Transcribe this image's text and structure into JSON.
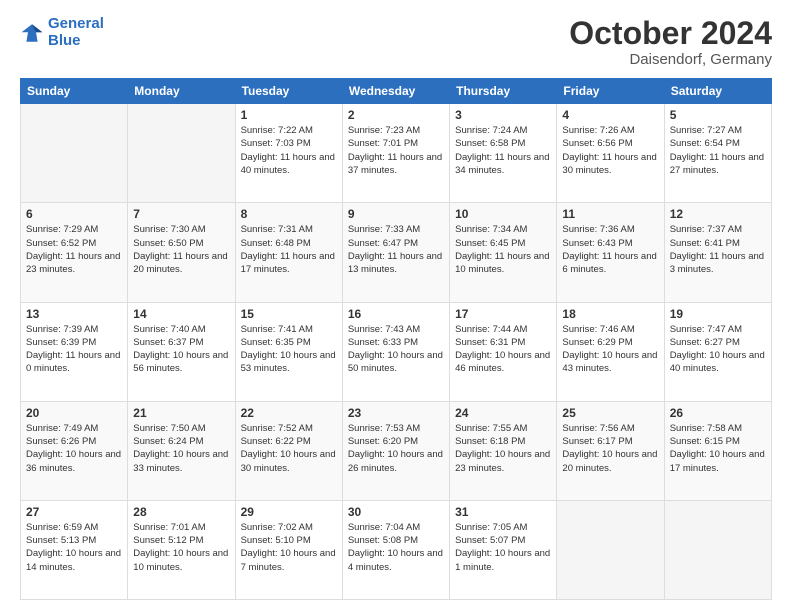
{
  "header": {
    "logo_line1": "General",
    "logo_line2": "Blue",
    "month": "October 2024",
    "location": "Daisendorf, Germany"
  },
  "weekdays": [
    "Sunday",
    "Monday",
    "Tuesday",
    "Wednesday",
    "Thursday",
    "Friday",
    "Saturday"
  ],
  "weeks": [
    [
      {
        "day": "",
        "info": ""
      },
      {
        "day": "",
        "info": ""
      },
      {
        "day": "1",
        "info": "Sunrise: 7:22 AM\nSunset: 7:03 PM\nDaylight: 11 hours and 40 minutes."
      },
      {
        "day": "2",
        "info": "Sunrise: 7:23 AM\nSunset: 7:01 PM\nDaylight: 11 hours and 37 minutes."
      },
      {
        "day": "3",
        "info": "Sunrise: 7:24 AM\nSunset: 6:58 PM\nDaylight: 11 hours and 34 minutes."
      },
      {
        "day": "4",
        "info": "Sunrise: 7:26 AM\nSunset: 6:56 PM\nDaylight: 11 hours and 30 minutes."
      },
      {
        "day": "5",
        "info": "Sunrise: 7:27 AM\nSunset: 6:54 PM\nDaylight: 11 hours and 27 minutes."
      }
    ],
    [
      {
        "day": "6",
        "info": "Sunrise: 7:29 AM\nSunset: 6:52 PM\nDaylight: 11 hours and 23 minutes."
      },
      {
        "day": "7",
        "info": "Sunrise: 7:30 AM\nSunset: 6:50 PM\nDaylight: 11 hours and 20 minutes."
      },
      {
        "day": "8",
        "info": "Sunrise: 7:31 AM\nSunset: 6:48 PM\nDaylight: 11 hours and 17 minutes."
      },
      {
        "day": "9",
        "info": "Sunrise: 7:33 AM\nSunset: 6:47 PM\nDaylight: 11 hours and 13 minutes."
      },
      {
        "day": "10",
        "info": "Sunrise: 7:34 AM\nSunset: 6:45 PM\nDaylight: 11 hours and 10 minutes."
      },
      {
        "day": "11",
        "info": "Sunrise: 7:36 AM\nSunset: 6:43 PM\nDaylight: 11 hours and 6 minutes."
      },
      {
        "day": "12",
        "info": "Sunrise: 7:37 AM\nSunset: 6:41 PM\nDaylight: 11 hours and 3 minutes."
      }
    ],
    [
      {
        "day": "13",
        "info": "Sunrise: 7:39 AM\nSunset: 6:39 PM\nDaylight: 11 hours and 0 minutes."
      },
      {
        "day": "14",
        "info": "Sunrise: 7:40 AM\nSunset: 6:37 PM\nDaylight: 10 hours and 56 minutes."
      },
      {
        "day": "15",
        "info": "Sunrise: 7:41 AM\nSunset: 6:35 PM\nDaylight: 10 hours and 53 minutes."
      },
      {
        "day": "16",
        "info": "Sunrise: 7:43 AM\nSunset: 6:33 PM\nDaylight: 10 hours and 50 minutes."
      },
      {
        "day": "17",
        "info": "Sunrise: 7:44 AM\nSunset: 6:31 PM\nDaylight: 10 hours and 46 minutes."
      },
      {
        "day": "18",
        "info": "Sunrise: 7:46 AM\nSunset: 6:29 PM\nDaylight: 10 hours and 43 minutes."
      },
      {
        "day": "19",
        "info": "Sunrise: 7:47 AM\nSunset: 6:27 PM\nDaylight: 10 hours and 40 minutes."
      }
    ],
    [
      {
        "day": "20",
        "info": "Sunrise: 7:49 AM\nSunset: 6:26 PM\nDaylight: 10 hours and 36 minutes."
      },
      {
        "day": "21",
        "info": "Sunrise: 7:50 AM\nSunset: 6:24 PM\nDaylight: 10 hours and 33 minutes."
      },
      {
        "day": "22",
        "info": "Sunrise: 7:52 AM\nSunset: 6:22 PM\nDaylight: 10 hours and 30 minutes."
      },
      {
        "day": "23",
        "info": "Sunrise: 7:53 AM\nSunset: 6:20 PM\nDaylight: 10 hours and 26 minutes."
      },
      {
        "day": "24",
        "info": "Sunrise: 7:55 AM\nSunset: 6:18 PM\nDaylight: 10 hours and 23 minutes."
      },
      {
        "day": "25",
        "info": "Sunrise: 7:56 AM\nSunset: 6:17 PM\nDaylight: 10 hours and 20 minutes."
      },
      {
        "day": "26",
        "info": "Sunrise: 7:58 AM\nSunset: 6:15 PM\nDaylight: 10 hours and 17 minutes."
      }
    ],
    [
      {
        "day": "27",
        "info": "Sunrise: 6:59 AM\nSunset: 5:13 PM\nDaylight: 10 hours and 14 minutes."
      },
      {
        "day": "28",
        "info": "Sunrise: 7:01 AM\nSunset: 5:12 PM\nDaylight: 10 hours and 10 minutes."
      },
      {
        "day": "29",
        "info": "Sunrise: 7:02 AM\nSunset: 5:10 PM\nDaylight: 10 hours and 7 minutes."
      },
      {
        "day": "30",
        "info": "Sunrise: 7:04 AM\nSunset: 5:08 PM\nDaylight: 10 hours and 4 minutes."
      },
      {
        "day": "31",
        "info": "Sunrise: 7:05 AM\nSunset: 5:07 PM\nDaylight: 10 hours and 1 minute."
      },
      {
        "day": "",
        "info": ""
      },
      {
        "day": "",
        "info": ""
      }
    ]
  ]
}
